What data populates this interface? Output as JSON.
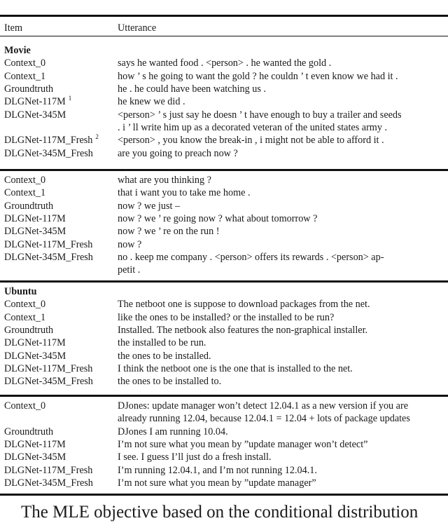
{
  "table": {
    "headers": {
      "item": "Item",
      "utterance": "Utterance"
    },
    "sections": [
      {
        "title": "Movie",
        "rows": [
          {
            "item": "Context_0",
            "utterance": [
              "says he wanted food . <person> . he wanted the gold ."
            ]
          },
          {
            "item": "Context_1",
            "utterance": [
              "how ’ s he going to want the gold ? he couldn ’ t even know we had it ."
            ]
          },
          {
            "item": "Groundtruth",
            "utterance": [
              "he . he could have been watching us ."
            ]
          },
          {
            "item": "DLGNet-117M",
            "footnote": "1",
            "utterance": [
              "he knew we did ."
            ]
          },
          {
            "item": "DLGNet-345M",
            "utterance": [
              "<person> ’ s just say he doesn ’ t have enough to buy a trailer and seeds",
              ". i ’ ll write him up as a decorated veteran of the united states army ."
            ]
          },
          {
            "item": "DLGNet-117M_Fresh",
            "footnote": "2",
            "utterance": [
              "<person> , you know the break-in , i might not be able to afford it ."
            ]
          },
          {
            "item": "DLGNet-345M_Fresh",
            "utterance": [
              "are you going to preach now ?"
            ]
          }
        ]
      },
      {
        "title": "",
        "rows": [
          {
            "item": "Context_0",
            "utterance": [
              "what are you thinking ?"
            ]
          },
          {
            "item": "Context_1",
            "utterance": [
              "that i want you to take me home ."
            ]
          },
          {
            "item": "Groundtruth",
            "utterance": [
              "now ? we just –"
            ]
          },
          {
            "item": "DLGNet-117M",
            "utterance": [
              "now ? we ’ re going now ? what about tomorrow ?"
            ]
          },
          {
            "item": "DLGNet-345M",
            "utterance": [
              "now ? we ’ re on the run !"
            ]
          },
          {
            "item": "DLGNet-117M_Fresh",
            "utterance": [
              "now ?"
            ]
          },
          {
            "item": "DLGNet-345M_Fresh",
            "utterance": [
              "no . keep me company . <person> offers its rewards . <person> ap-",
              "petit ."
            ]
          }
        ]
      },
      {
        "title": "Ubuntu",
        "rows": [
          {
            "item": "Context_0",
            "utterance": [
              "The netboot one is suppose to download packages from the net."
            ]
          },
          {
            "item": "Context_1",
            "utterance": [
              "like the ones to be installed? or the installed to be run?"
            ]
          },
          {
            "item": "Groundtruth",
            "utterance": [
              "Installed. The netbook also features the non-graphical installer."
            ]
          },
          {
            "item": "DLGNet-117M",
            "utterance": [
              "the installed to be run."
            ]
          },
          {
            "item": "DLGNet-345M",
            "utterance": [
              "the ones to be installed."
            ]
          },
          {
            "item": "DLGNet-117M_Fresh",
            "utterance": [
              "I think the netboot one is the one that is installed to the net."
            ]
          },
          {
            "item": "DLGNet-345M_Fresh",
            "utterance": [
              "the ones to be installed to."
            ]
          }
        ]
      },
      {
        "title": "",
        "rows": [
          {
            "item": "Context_0",
            "utterance": [
              "DJones: update manager won’t detect 12.04.1 as a new version if you are",
              "already running 12.04, because 12.04.1 = 12.04 + lots of package updates"
            ]
          },
          {
            "item": "Groundtruth",
            "utterance": [
              "DJones I am running 10.04."
            ]
          },
          {
            "item": "DLGNet-117M",
            "utterance": [
              "I’m not sure what you mean by ”update manager won’t detect”"
            ]
          },
          {
            "item": "DLGNet-345M",
            "utterance": [
              "I see. I guess I’ll just do a fresh install."
            ]
          },
          {
            "item": "DLGNet-117M_Fresh",
            "utterance": [
              "I’m running 12.04.1, and I’m not running 12.04.1."
            ]
          },
          {
            "item": "DLGNet-345M_Fresh",
            "utterance": [
              "I’m not sure what you mean by ”update manager”"
            ]
          }
        ]
      }
    ]
  },
  "body_text": "The MLE objective based on the conditional distribution"
}
